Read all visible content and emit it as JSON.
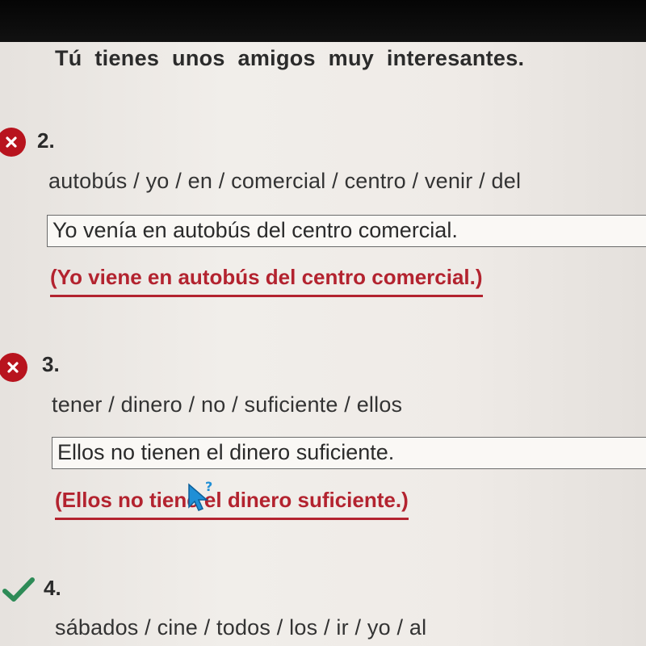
{
  "previous_answer": "Tú tienes unos amigos muy interesantes.",
  "colors": {
    "incorrect": "#b8141e",
    "correct": "#2e8b57",
    "correction_text": "#b3232f",
    "cursor": "#1f8fd6"
  },
  "questions": [
    {
      "number": "2.",
      "status": "incorrect",
      "prompt": "autobús / yo / en / comercial / centro / venir / del",
      "answer": "Yo venía en autobús del centro comercial.",
      "correction": "(Yo viene en autobús del centro comercial.)"
    },
    {
      "number": "3.",
      "status": "incorrect",
      "prompt": "tener / dinero / no / suficiente / ellos",
      "answer": "Ellos no tienen el dinero suficiente.",
      "correction": "(Ellos no tiene el dinero suficiente.)"
    },
    {
      "number": "4.",
      "status": "correct",
      "prompt": "sábados / cine / todos / los / ir / yo / al"
    }
  ],
  "icons": {
    "incorrect": "close-circle-icon",
    "correct": "checkmark-icon",
    "pointer": "help-cursor-icon"
  }
}
